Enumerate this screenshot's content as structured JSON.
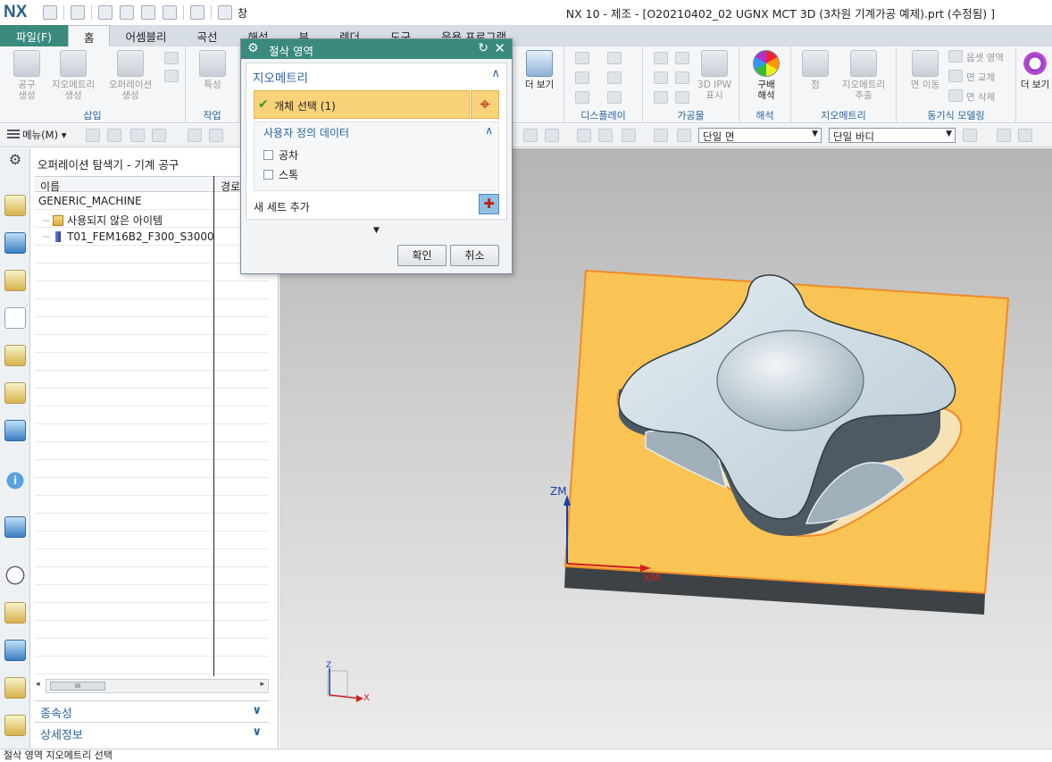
{
  "titlebar": {
    "logo": "NX",
    "window_menu": "창",
    "title": "NX 10 - 제조 - [O20210402_02 UGNX MCT 3D (3차원 기계가공 예제).prt (수정됨) ]"
  },
  "ribbon_tabs": [
    "파일(F)",
    "홈",
    "어셈블리",
    "곡선",
    "해석",
    "뷰",
    "렌더",
    "도구",
    "응용 프로그램"
  ],
  "ribbon": {
    "insert_group": {
      "label": "삽입",
      "buttons": [
        "공구\n생성",
        "지오메트리\n생성",
        "오퍼레이션\n생성"
      ]
    },
    "operation_group": {
      "label": "작업",
      "buttons": [
        "특성"
      ]
    },
    "display_more": "더 보기",
    "display_group_label": "디스플레이",
    "workpiece_group": {
      "label": "가공물",
      "buttons": [
        "3D IPW\n표시"
      ]
    },
    "analysis_group": {
      "label": "해석",
      "buttons": [
        "구배\n해석"
      ]
    },
    "geometry_group": {
      "label": "지오메트리",
      "buttons": [
        "점",
        "지오메트리\n추출"
      ]
    },
    "sync_group": {
      "label": "동기식 모델링",
      "buttons": [
        "면 이동",
        "옵셋 영역",
        "면 교체",
        "면 삭제"
      ]
    },
    "more_right": "더 보기"
  },
  "selection_bar": {
    "menu_label": "메뉴(M)",
    "filter_face": "단일 면",
    "filter_body": "단일 바디"
  },
  "navigator": {
    "title": "오퍼레이션 탐색기 - 기계 공구",
    "columns": [
      "이름",
      "경로"
    ],
    "rows": [
      {
        "name": "GENERIC_MACHINE",
        "icon": "none"
      },
      {
        "name": "사용되지 않은 아이템",
        "icon": "folder-icon"
      },
      {
        "name": "T01_FEM16B2_F300_S3000",
        "icon": "tool-icon"
      }
    ],
    "scroll_thumb": "III",
    "sections": [
      "종속성",
      "상세정보"
    ]
  },
  "dialog": {
    "title": "절삭 영역",
    "group_geometry": "지오메트리",
    "select_object": "개체 선택 (1)",
    "user_data_header": "사용자 정의 데이터",
    "checkbox_tolerance": "공차",
    "checkbox_stock": "스톡",
    "add_new_set": "새 세트 추가",
    "ok": "확인",
    "cancel": "취소"
  },
  "viewport": {
    "wcs_z": "ZM",
    "wcs_x": "XM",
    "triad_z": "Z",
    "triad_x": "X",
    "colors": {
      "stock_top": "#f9c453",
      "stock_edge": "#f08a2a",
      "part_body": "#cfdde6",
      "part_side": "#4e5a63",
      "axis_blue": "#1a3fa6",
      "axis_red": "#d21e1e"
    }
  },
  "status_bar": {
    "text": "절삭 영역 지오메트리 선택"
  }
}
